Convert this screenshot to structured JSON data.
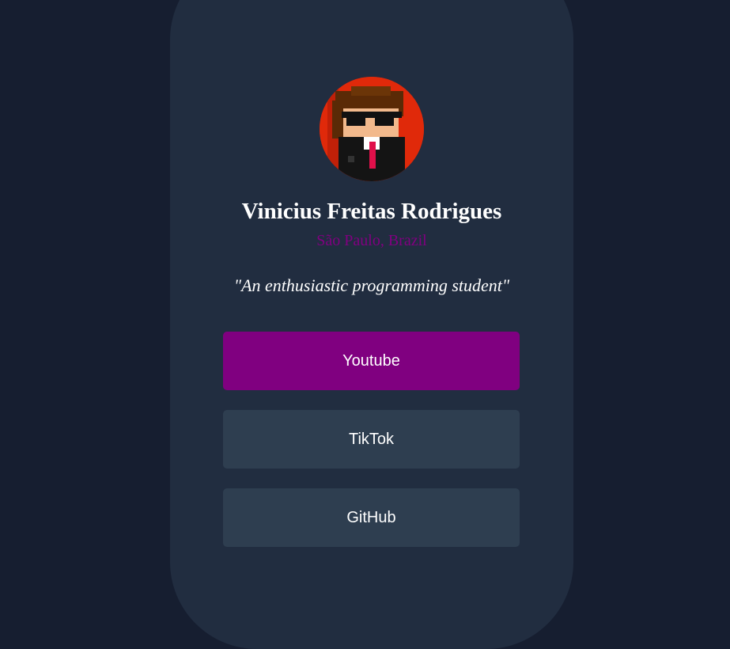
{
  "profile": {
    "name": "Vinicius Freitas Rodrigues",
    "location": "São Paulo, Brazil",
    "bio": "\"An enthusiastic programming student\"",
    "avatar_icon": "pixel-art-agent-avatar"
  },
  "links": [
    {
      "label": "Youtube",
      "active": true
    },
    {
      "label": "TikTok",
      "active": false
    },
    {
      "label": "GitHub",
      "active": false
    }
  ],
  "colors": {
    "page_background": "#161e30",
    "card_background": "#212d40",
    "button_background": "#2e3e50",
    "accent": "#800080",
    "text": "#ffffff"
  }
}
